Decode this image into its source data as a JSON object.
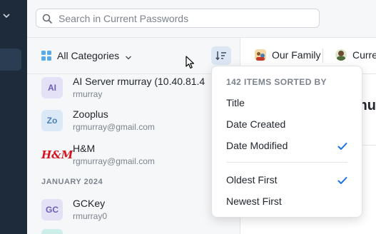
{
  "search": {
    "placeholder": "Search in Current Passwords"
  },
  "list": {
    "category_label": "All Categories",
    "items_top": [
      {
        "initials": "AI",
        "title": "AI Server rmurray (10.40.81.4",
        "subtitle": "rmurray",
        "avatar_bg": "#e4e0f5",
        "avatar_fg": "#6b5fb5"
      },
      {
        "initials": "Zo",
        "title": "Zooplus",
        "subtitle": "rgmurray@gmail.com",
        "avatar_bg": "#dbe9f6",
        "avatar_fg": "#4a7fb5"
      },
      {
        "initials": "H&M",
        "title": "H&M",
        "subtitle": "rgmurray@gmail.com"
      }
    ],
    "section_label": "JANUARY 2024",
    "items_bottom": [
      {
        "initials": "GC",
        "title": "GCKey",
        "subtitle": "rmurray0",
        "avatar_bg": "#e4e0f5",
        "avatar_fg": "#6b5fb5"
      }
    ]
  },
  "vaults": [
    {
      "name": "Our Family"
    },
    {
      "name": "Curre"
    }
  ],
  "detail": {
    "title": "mur"
  },
  "sort_menu": {
    "header": "142 ITEMS SORTED BY",
    "fields": [
      {
        "label": "Title",
        "selected": false
      },
      {
        "label": "Date Created",
        "selected": false
      },
      {
        "label": "Date Modified",
        "selected": true
      }
    ],
    "orders": [
      {
        "label": "Oldest First",
        "selected": true
      },
      {
        "label": "Newest First",
        "selected": false
      }
    ]
  },
  "colors": {
    "accent": "#1a73e8",
    "sidebar": "#1d2b3a"
  },
  "icons": [
    "chevron-down-icon",
    "search-icon",
    "category-grid-icon",
    "sort-icon",
    "checkmark-icon",
    "cursor-icon",
    "vault-icon"
  ]
}
